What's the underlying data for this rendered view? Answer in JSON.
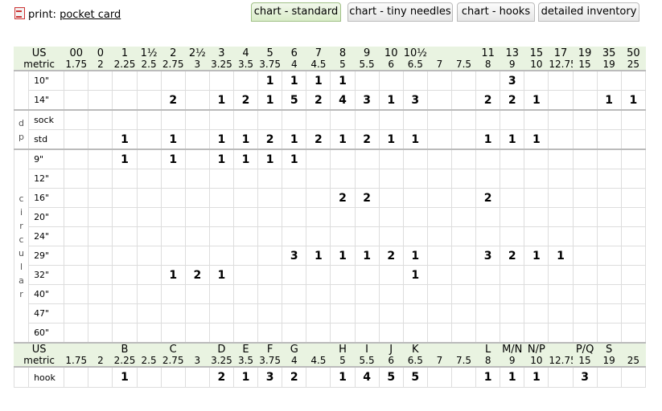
{
  "print": {
    "prefix": "print:",
    "link": "pocket card",
    "icon": "pdf-icon"
  },
  "tabs": [
    {
      "label": "chart - standard",
      "active": true
    },
    {
      "label": "chart - tiny needles",
      "active": false
    },
    {
      "label": "chart - hooks",
      "active": false
    },
    {
      "label": "detailed inventory",
      "active": false
    }
  ],
  "colors": {
    "header_bg": "#e9f3e1",
    "active_tab": "#d9ecc8",
    "grid_line": "#dddddd"
  },
  "needle_header": {
    "us_label": "US",
    "metric_label": "metric",
    "us": [
      "00",
      "0",
      "1",
      "1½",
      "2",
      "2½",
      "3",
      "4",
      "5",
      "6",
      "7",
      "8",
      "9",
      "10",
      "10½",
      "",
      "",
      "11",
      "13",
      "15",
      "17",
      "19",
      "35",
      "50"
    ],
    "metric": [
      "1.75",
      "2",
      "2.25",
      "2.5",
      "2.75",
      "3",
      "3.25",
      "3.5",
      "3.75",
      "4",
      "4.5",
      "5",
      "5.5",
      "6",
      "6.5",
      "7",
      "7.5",
      "8",
      "9",
      "10",
      "12.75",
      "15",
      "19",
      "25"
    ]
  },
  "hook_header": {
    "us_label": "US",
    "metric_label": "metric",
    "us": [
      "",
      "",
      "B",
      "",
      "C",
      "",
      "D",
      "E",
      "F",
      "G",
      "",
      "H",
      "I",
      "J",
      "K",
      "",
      "",
      "L",
      "M/N",
      "N/P",
      "",
      "P/Q",
      "S",
      ""
    ],
    "metric": [
      "1.75",
      "2",
      "2.25",
      "2.5",
      "2.75",
      "3",
      "3.25",
      "3.5",
      "3.75",
      "4",
      "4.5",
      "5",
      "5.5",
      "6",
      "6.5",
      "7",
      "7.5",
      "8",
      "9",
      "10",
      "12.75",
      "15",
      "19",
      "25"
    ]
  },
  "sections": [
    {
      "group": "",
      "rows": [
        {
          "label": "10\"",
          "cells": [
            "",
            "",
            "",
            "",
            "",
            "",
            "",
            "",
            "1",
            "1",
            "1",
            "1",
            "",
            "",
            "",
            "",
            "",
            "",
            "3",
            "",
            "",
            "",
            "",
            ""
          ]
        },
        {
          "label": "14\"",
          "cells": [
            "",
            "",
            "",
            "",
            "2",
            "",
            "1",
            "2",
            "1",
            "5",
            "2",
            "4",
            "3",
            "1",
            "3",
            "",
            "",
            "2",
            "2",
            "1",
            "",
            "",
            "1",
            "1"
          ]
        }
      ]
    },
    {
      "group": "dp",
      "rows": [
        {
          "label": "sock",
          "cells": [
            "",
            "",
            "",
            "",
            "",
            "",
            "",
            "",
            "",
            "",
            "",
            "",
            "",
            "",
            "",
            "",
            "",
            "",
            "",
            "",
            "",
            "",
            "",
            ""
          ]
        },
        {
          "label": "std",
          "cells": [
            "",
            "",
            "1",
            "",
            "1",
            "",
            "1",
            "1",
            "2",
            "1",
            "2",
            "1",
            "2",
            "1",
            "1",
            "",
            "",
            "1",
            "1",
            "1",
            "",
            "",
            "",
            ""
          ]
        }
      ]
    },
    {
      "group": "circular",
      "rows": [
        {
          "label": "9\"",
          "cells": [
            "",
            "",
            "1",
            "",
            "1",
            "",
            "1",
            "1",
            "1",
            "1",
            "",
            "",
            "",
            "",
            "",
            "",
            "",
            "",
            "",
            "",
            "",
            "",
            "",
            ""
          ]
        },
        {
          "label": "12\"",
          "cells": [
            "",
            "",
            "",
            "",
            "",
            "",
            "",
            "",
            "",
            "",
            "",
            "",
            "",
            "",
            "",
            "",
            "",
            "",
            "",
            "",
            "",
            "",
            "",
            ""
          ]
        },
        {
          "label": "16\"",
          "cells": [
            "",
            "",
            "",
            "",
            "",
            "",
            "",
            "",
            "",
            "",
            "",
            "2",
            "2",
            "",
            "",
            "",
            "",
            "2",
            "",
            "",
            "",
            "",
            "",
            ""
          ]
        },
        {
          "label": "20\"",
          "cells": [
            "",
            "",
            "",
            "",
            "",
            "",
            "",
            "",
            "",
            "",
            "",
            "",
            "",
            "",
            "",
            "",
            "",
            "",
            "",
            "",
            "",
            "",
            "",
            ""
          ]
        },
        {
          "label": "24\"",
          "cells": [
            "",
            "",
            "",
            "",
            "",
            "",
            "",
            "",
            "",
            "",
            "",
            "",
            "",
            "",
            "",
            "",
            "",
            "",
            "",
            "",
            "",
            "",
            "",
            ""
          ]
        },
        {
          "label": "29\"",
          "cells": [
            "",
            "",
            "",
            "",
            "",
            "",
            "",
            "",
            "",
            "3",
            "1",
            "1",
            "1",
            "2",
            "1",
            "",
            "",
            "3",
            "2",
            "1",
            "1",
            "",
            "",
            ""
          ]
        },
        {
          "label": "32\"",
          "cells": [
            "",
            "",
            "",
            "",
            "1",
            "2",
            "1",
            "",
            "",
            "",
            "",
            "",
            "",
            "",
            "1",
            "",
            "",
            "",
            "",
            "",
            "",
            "",
            "",
            ""
          ]
        },
        {
          "label": "40\"",
          "cells": [
            "",
            "",
            "",
            "",
            "",
            "",
            "",
            "",
            "",
            "",
            "",
            "",
            "",
            "",
            "",
            "",
            "",
            "",
            "",
            "",
            "",
            "",
            "",
            ""
          ]
        },
        {
          "label": "47\"",
          "cells": [
            "",
            "",
            "",
            "",
            "",
            "",
            "",
            "",
            "",
            "",
            "",
            "",
            "",
            "",
            "",
            "",
            "",
            "",
            "",
            "",
            "",
            "",
            "",
            ""
          ]
        },
        {
          "label": "60\"",
          "cells": [
            "",
            "",
            "",
            "",
            "",
            "",
            "",
            "",
            "",
            "",
            "",
            "",
            "",
            "",
            "",
            "",
            "",
            "",
            "",
            "",
            "",
            "",
            "",
            ""
          ]
        }
      ]
    }
  ],
  "hooks": {
    "label": "hook",
    "cells": [
      "",
      "",
      "1",
      "",
      "",
      "",
      "2",
      "1",
      "3",
      "2",
      "",
      "1",
      "4",
      "5",
      "5",
      "",
      "",
      "1",
      "1",
      "1",
      "",
      "3",
      "",
      ""
    ]
  }
}
